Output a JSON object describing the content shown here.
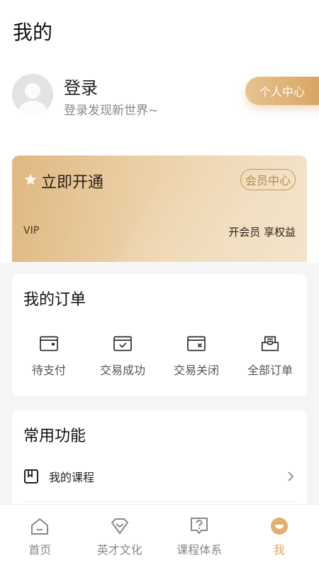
{
  "page": {
    "title": "我的"
  },
  "user": {
    "login_title": "登录",
    "login_subtitle": "登录发现新世界~",
    "profile_button": "个人中心"
  },
  "vip": {
    "title": "立即开通",
    "member_center": "会员中心",
    "label": "VIP",
    "benefit": "开会员 享权益",
    "accent_color": "#d7a463"
  },
  "orders": {
    "title": "我的订单",
    "items": [
      {
        "label": "待支付",
        "icon": "wallet-icon"
      },
      {
        "label": "交易成功",
        "icon": "check-box-icon"
      },
      {
        "label": "交易关闭",
        "icon": "close-box-icon"
      },
      {
        "label": "全部订单",
        "icon": "inbox-icon"
      }
    ]
  },
  "functions": {
    "title": "常用功能",
    "items": [
      {
        "label": "我的课程",
        "icon": "book-icon"
      }
    ]
  },
  "tabbar": {
    "items": [
      {
        "label": "首页",
        "icon": "home-icon",
        "active": false
      },
      {
        "label": "英才文化",
        "icon": "diamond-icon",
        "active": false
      },
      {
        "label": "课程体系",
        "icon": "question-icon",
        "active": false
      },
      {
        "label": "我",
        "icon": "smile-icon",
        "active": true
      }
    ],
    "active_color": "#d9a660",
    "inactive_color": "#888888"
  }
}
